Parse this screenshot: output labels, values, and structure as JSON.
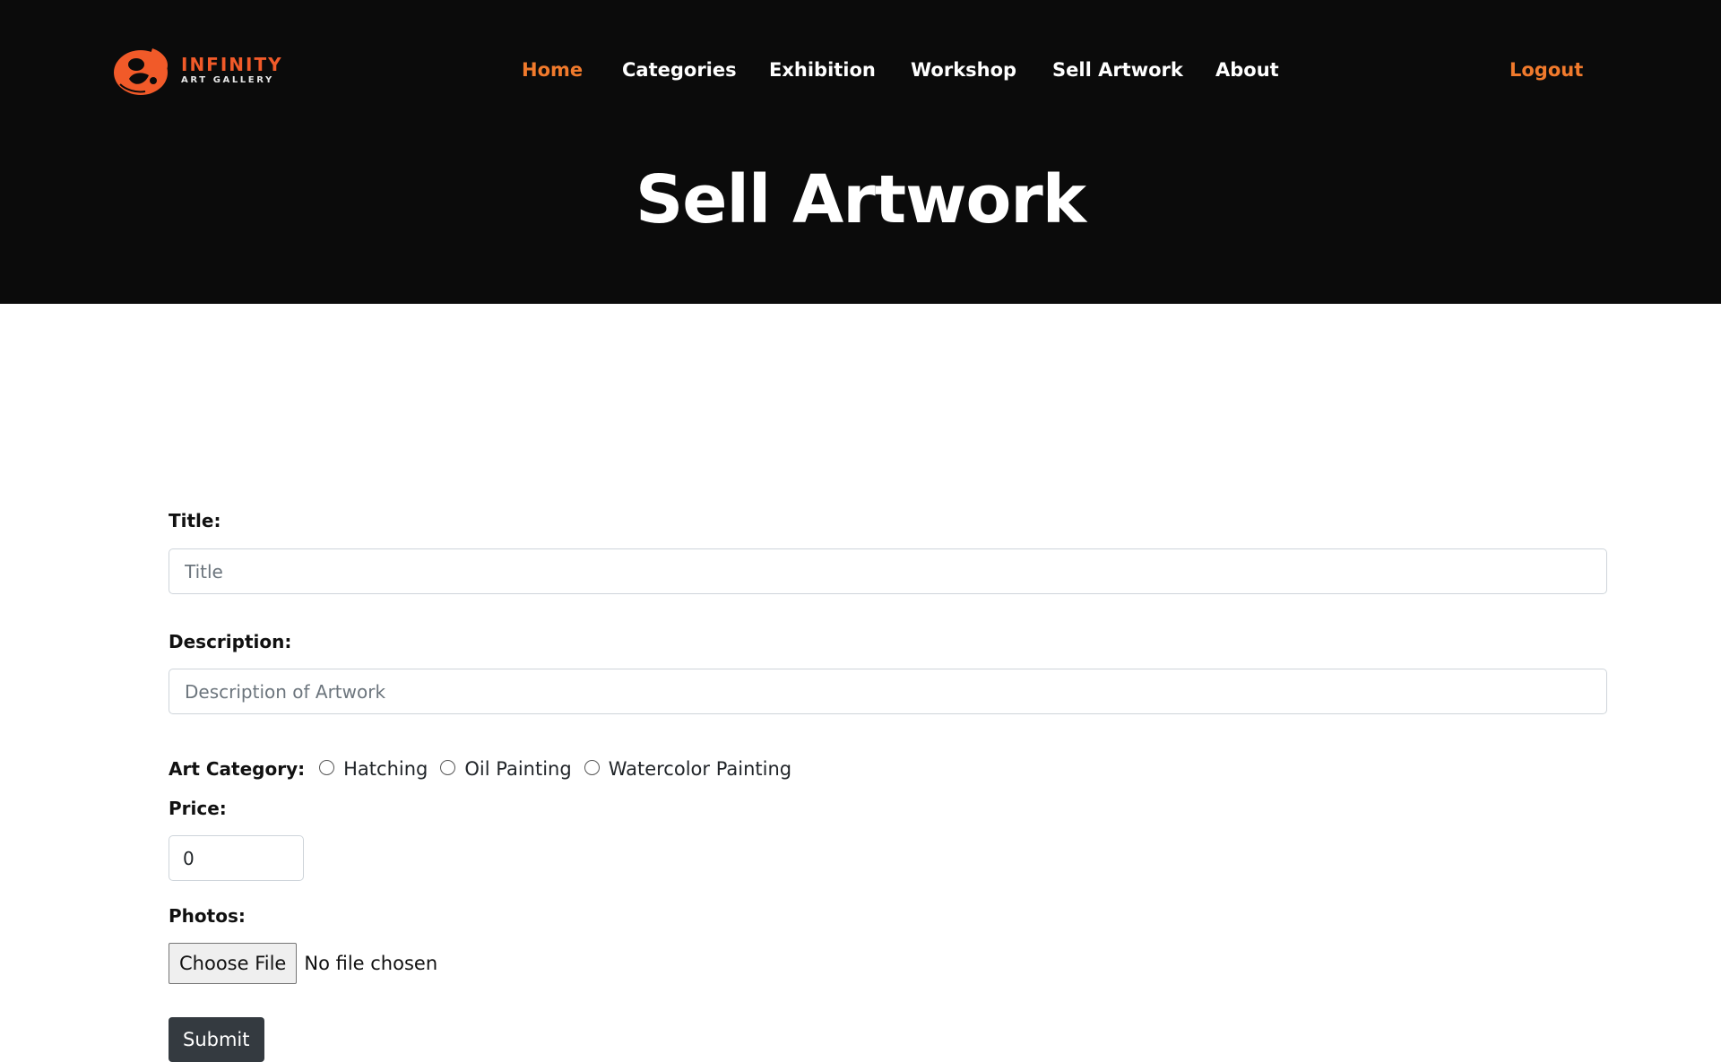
{
  "brand": {
    "name": "INFINITY",
    "subtitle": "ART GALLERY",
    "accent_color": "#f15a29"
  },
  "nav": {
    "items": [
      {
        "label": "Home",
        "active": true
      },
      {
        "label": "Categories",
        "active": false
      },
      {
        "label": "Exhibition",
        "active": false
      },
      {
        "label": "Workshop",
        "active": false
      },
      {
        "label": "Sell Artwork",
        "active": false
      },
      {
        "label": "About",
        "active": false
      }
    ],
    "logout_label": "Logout",
    "active_color": "#f17a2c"
  },
  "hero": {
    "title": "Sell Artwork",
    "background_color": "#0b0b0b"
  },
  "form": {
    "title_label": "Title:",
    "title_placeholder": "Title",
    "description_label": "Description:",
    "description_placeholder": "Description of Artwork",
    "category_label": "Art Category:",
    "categories": [
      "Hatching",
      "Oil Painting",
      "Watercolor Painting"
    ],
    "price_label": "Price:",
    "price_value": "0",
    "photos_label": "Photos:",
    "file_button_label": "Choose File",
    "file_status": "No file chosen",
    "submit_label": "Submit"
  }
}
